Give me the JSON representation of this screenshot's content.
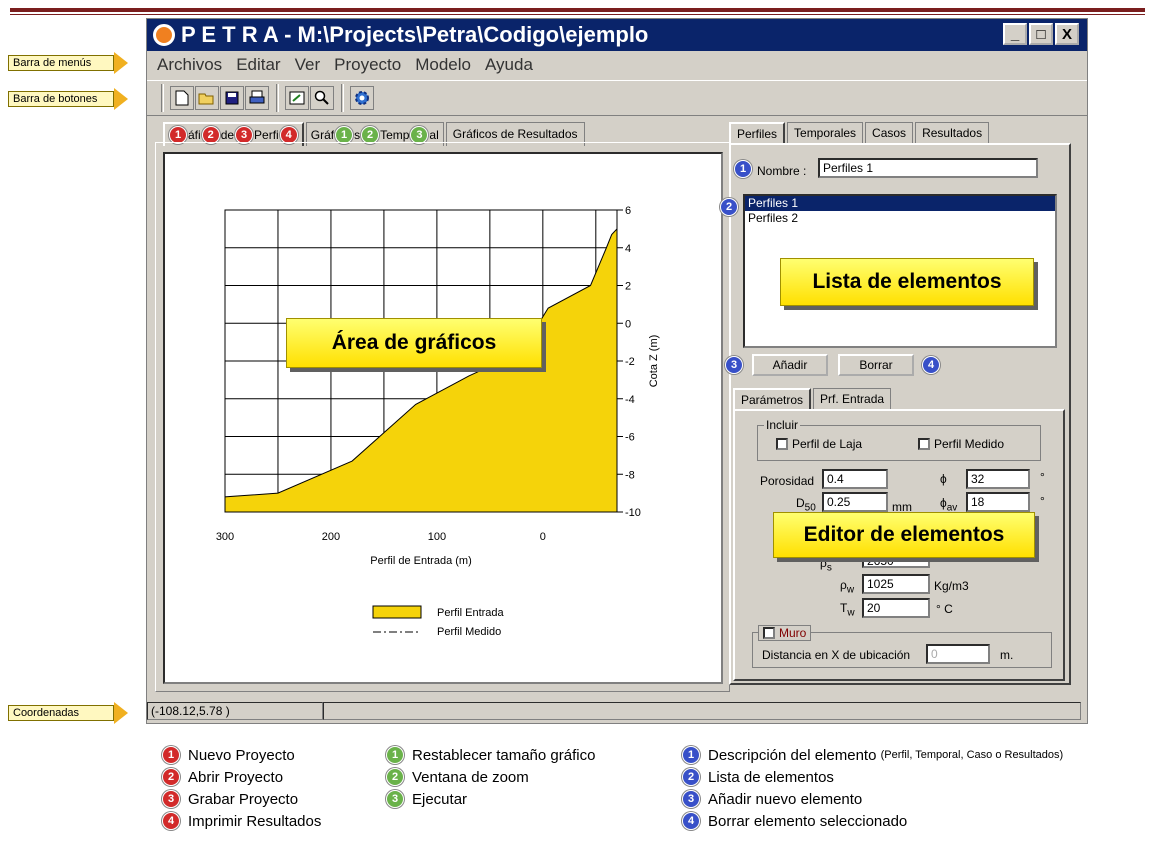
{
  "window": {
    "title": "P E T R A - M:\\Projects\\Petra\\Codigo\\ejemplo",
    "minimize": "_",
    "maximize": "□",
    "close": "X"
  },
  "annotations": {
    "menubar": "Barra de menús",
    "toolbar": "Barra de botones",
    "coords": "Coordenadas",
    "graph_area": "Área de gráficos",
    "element_list": "Lista de elementos",
    "element_editor": "Editor de elementos"
  },
  "menu": [
    "Archivos",
    "Editar",
    "Ver",
    "Proyecto",
    "Modelo",
    "Ayuda"
  ],
  "toolbar_icons": [
    "new-file-icon",
    "open-folder-icon",
    "save-icon",
    "print-icon",
    "reset-size-icon",
    "zoom-icon",
    "run-icon"
  ],
  "graph_tabs": [
    "Gráficos de Perfiles",
    "Gráficos Temporal",
    "Gráficos de Resultados"
  ],
  "graph_tab_visible": [
    "áfi",
    "de",
    "Perfi",
    "Gráf",
    "s",
    "Temp",
    "al"
  ],
  "right_tabs": [
    "Perfiles",
    "Temporales",
    "Casos",
    "Resultados"
  ],
  "nombre_label": "Nombre :",
  "nombre_value": "Perfiles 1",
  "list_items": [
    "Perfiles 1",
    "Perfiles 2"
  ],
  "add_button": "Añadir",
  "delete_button": "Borrar",
  "editor_tabs": [
    "Parámetros",
    "Prf. Entrada"
  ],
  "incluir": {
    "title": "Incluir",
    "perfil_laja": "Perfil de Laja",
    "perfil_medido": "Perfil Medido"
  },
  "params": {
    "porosidad_label": "Porosidad",
    "porosidad_value": "0.4",
    "phi_label": "ϕ",
    "phi_value": "32",
    "phi_unit": "°",
    "d50_label": "D",
    "d50_sub": "50",
    "d50_value": "0.25",
    "d50_unit": "mm",
    "phiav_label": "ϕ",
    "phiav_sub": "av",
    "phiav_value": "18",
    "phiav_unit": "°",
    "rhos_label": "ρ",
    "rhos_sub": "s",
    "rhos_value": "2650",
    "rhow_label": "ρ",
    "rhow_sub": "w",
    "rhow_value": "1025",
    "rhow_unit": "Kg/m3",
    "tw_label": "T",
    "tw_sub": "w",
    "tw_value": "20",
    "tw_unit": "° C"
  },
  "muro": {
    "title": "Muro",
    "distancia_label": "Distancia en X de ubicación",
    "distancia_value": "0",
    "unit": "m."
  },
  "status": {
    "coords": "(-108.12,5.78 )"
  },
  "chart_data": {
    "type": "area",
    "xlabel": "Perfil de Entrada  (m)",
    "ylabel": "Cota Z (m)",
    "xlim": [
      300,
      -70
    ],
    "ylim": [
      -10,
      6
    ],
    "xticks": [
      "300",
      "200",
      "100",
      "0"
    ],
    "yticks": [
      "6",
      "4",
      "2",
      "0",
      "-2",
      "-4",
      "-6",
      "-8",
      "-10"
    ],
    "series": [
      {
        "name": "Perfil Entrada",
        "x": [
          300,
          250,
          180,
          120,
          70,
          20,
          -5,
          -45,
          -60,
          -65,
          -70
        ],
        "y": [
          -9.2,
          -9.0,
          -7.3,
          -4.3,
          -2.8,
          -1.5,
          0.8,
          2.0,
          4.0,
          4.7,
          5.0
        ]
      },
      {
        "name": "Perfil Medido",
        "x": [],
        "y": []
      }
    ],
    "legend": "bottom-center"
  },
  "legend_bottom": {
    "red": [
      "Nuevo Proyecto",
      "Abrir Proyecto",
      "Grabar Proyecto",
      "Imprimir Resultados"
    ],
    "green": [
      "Restablecer tamaño gráfico",
      "Ventana de zoom",
      "Ejecutar"
    ],
    "blue": [
      "Descripción del elemento",
      "Lista de elementos",
      "Añadir nuevo elemento",
      "Borrar elemento seleccionado"
    ],
    "blue_first_suffix": "(Perfil, Temporal, Caso o Resultados)"
  },
  "numbers": [
    "1",
    "2",
    "3",
    "4"
  ]
}
